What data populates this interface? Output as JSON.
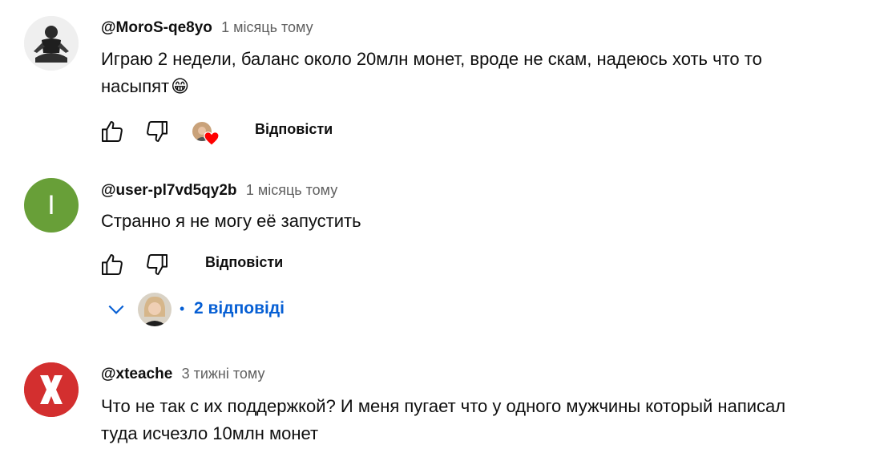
{
  "comments": [
    {
      "author": "@MoroS-qe8yo",
      "time": "1 місяць тому",
      "text_line1": "Играю 2 недели, баланс около 20млн монет, вроде не скам, надеюсь хоть что то",
      "text_line2": "насыпят",
      "emoji": "😁",
      "reply_label": "Відповісти",
      "hearted": true
    },
    {
      "author": "@user-pl7vd5qy2b",
      "time": "1 місяць тому",
      "text": "Странно я не могу её запустить",
      "avatar_letter": "I",
      "avatar_color": "#689f38",
      "reply_label": "Відповісти",
      "replies_dot": "•",
      "replies_count": "2 відповіді"
    },
    {
      "author": "@xteache",
      "time": "3 тижні тому",
      "text_line1": "Что не так с их поддержкой? И меня пугает что у одного мужчины который написал",
      "text_line2": "туда исчезло 10млн монет",
      "avatar_color": "#d32f2f"
    }
  ],
  "colors": {
    "link_blue": "#065fd4",
    "heart_red": "#ff0000",
    "meta_gray": "#606060"
  },
  "icons": [
    "like-icon",
    "dislike-icon",
    "creator-heart-icon",
    "chevron-down-icon"
  ]
}
